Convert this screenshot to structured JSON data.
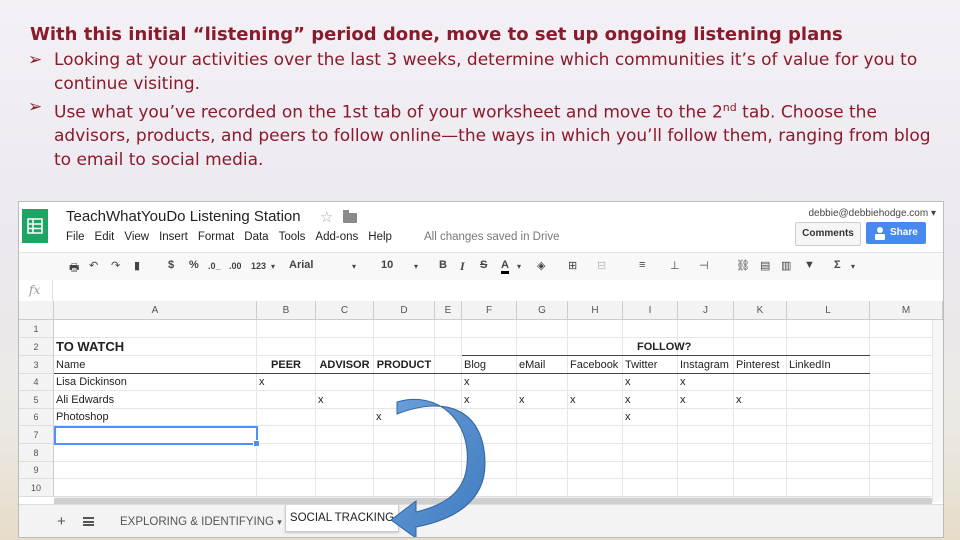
{
  "slide": {
    "title": "With this initial “listening” period done, move to set up ongoing listening plans",
    "bullets": [
      "Looking at your activities over the last 3 weeks, determine which communities it’s of value for you to continue visiting.",
      {
        "pre": "Use what you’ve recorded on the 1st tab of your worksheet and move to the 2",
        "sup": "nd",
        "post": " tab. Choose the advisors, products, and peers to follow online—the ways in which you’ll follow them, ranging from blog to email to social media."
      }
    ],
    "bullet_glyph": "➢"
  },
  "app": {
    "doc_title": "TeachWhatYouDo Listening Station",
    "menu": [
      "File",
      "Edit",
      "View",
      "Insert",
      "Format",
      "Data",
      "Tools",
      "Add-ons",
      "Help"
    ],
    "save_status": "All changes saved in Drive",
    "user_email": "debbie@debbiehodge.com",
    "comments_label": "Comments",
    "share_label": "Share",
    "accent": "#4889f1",
    "logo_color": "#1fa463"
  },
  "toolbar": {
    "currency": "$",
    "percent": "%",
    "dec_less": ".0_",
    "dec_more": ".00",
    "more_formats": "123",
    "font": "Arial",
    "font_size": "10",
    "bold": "B",
    "italic": "I",
    "strike": "S",
    "textcolor": "A",
    "sigma": "Σ"
  },
  "formula": {
    "fx": "fx"
  },
  "grid": {
    "columns": [
      "A",
      "B",
      "C",
      "D",
      "E",
      "F",
      "G",
      "H",
      "I",
      "J",
      "K",
      "L",
      "M"
    ],
    "rows": [
      "1",
      "2",
      "3",
      "4",
      "5",
      "6",
      "7",
      "8",
      "9",
      "10"
    ],
    "to_watch": "TO WATCH",
    "follow_header": "FOLLOW?",
    "row3": [
      "Name",
      "PEER",
      "ADVISOR",
      "PRODUCT",
      "",
      "Blog",
      "eMail",
      "Facebook",
      "Twitter",
      "Instagram",
      "Pinterest",
      "LinkedIn"
    ],
    "data_rows": [
      [
        "Lisa Dickinson",
        "x",
        "",
        "",
        "",
        "x",
        "",
        "",
        "x",
        "x",
        "",
        ""
      ],
      [
        "Ali Edwards",
        "",
        "x",
        "",
        "",
        "x",
        "x",
        "x",
        "x",
        "x",
        "x",
        ""
      ],
      [
        "Photoshop",
        "",
        "",
        "x",
        "",
        "",
        "",
        "",
        "x",
        "",
        "",
        ""
      ]
    ]
  },
  "sheet_tabs": [
    "EXPLORING & IDENTIFYING",
    "SOCIAL TRACKING"
  ],
  "annotation_arrow_color": "#4a86c8"
}
